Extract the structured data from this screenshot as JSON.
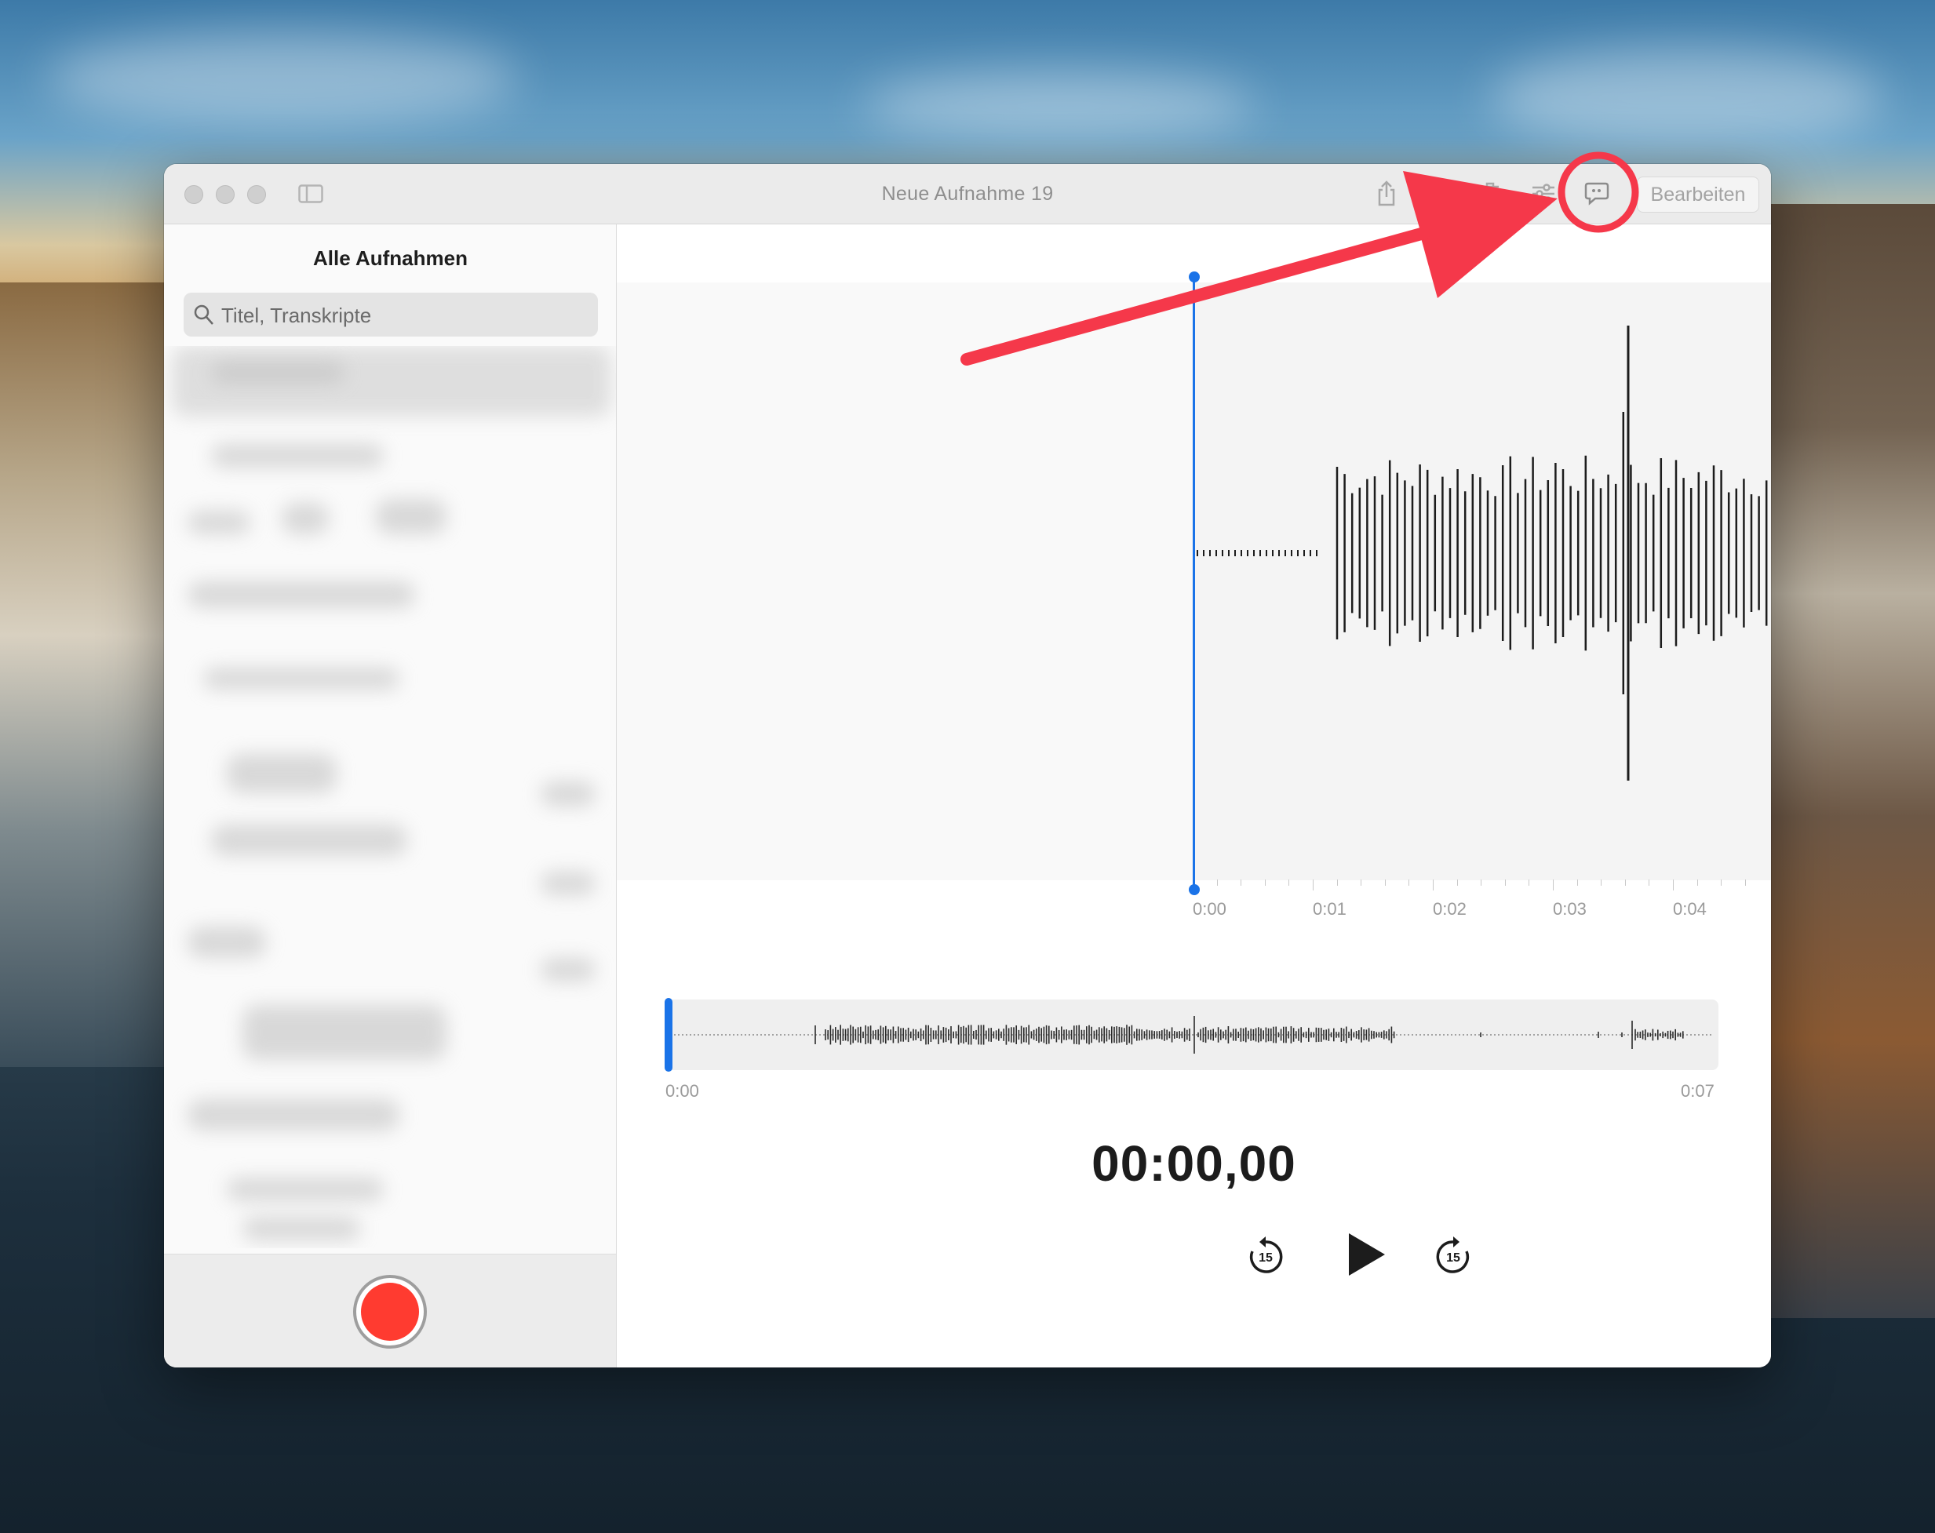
{
  "window": {
    "title": "Neue Aufnahme 19",
    "edit_label": "Bearbeiten"
  },
  "toolbar": {
    "icons": [
      "sidebar-toggle-icon",
      "share-icon",
      "trash-icon",
      "sliders-icon",
      "transcript-icon"
    ]
  },
  "sidebar": {
    "title": "Alle Aufnahmen",
    "search_placeholder": "Titel, Transkripte"
  },
  "waveform": {
    "axis_labels": [
      "0:00",
      "0:01",
      "0:02",
      "0:03",
      "0:04"
    ]
  },
  "overview": {
    "start_label": "0:00",
    "end_label": "0:07"
  },
  "player": {
    "timer": "00:00,00",
    "skip_back": "15",
    "skip_forward": "15"
  },
  "colors": {
    "accent_blue": "#1a73e8",
    "record_red": "#ff3b30",
    "annotation_red": "#f5384a"
  }
}
